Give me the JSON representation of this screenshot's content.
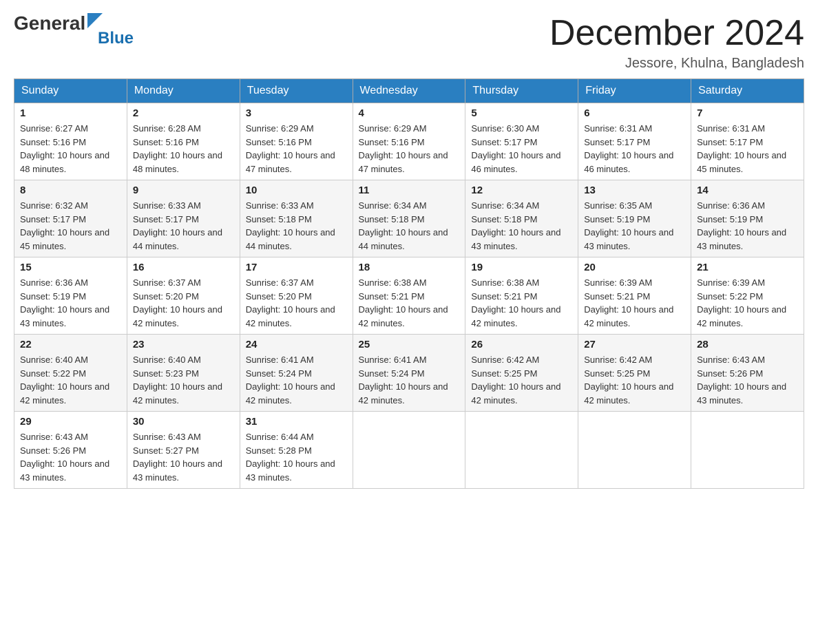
{
  "logo": {
    "general": "General",
    "blue": "Blue"
  },
  "header": {
    "month_year": "December 2024",
    "location": "Jessore, Khulna, Bangladesh"
  },
  "weekdays": [
    "Sunday",
    "Monday",
    "Tuesday",
    "Wednesday",
    "Thursday",
    "Friday",
    "Saturday"
  ],
  "weeks": [
    [
      {
        "day": "1",
        "sunrise": "6:27 AM",
        "sunset": "5:16 PM",
        "daylight": "10 hours and 48 minutes."
      },
      {
        "day": "2",
        "sunrise": "6:28 AM",
        "sunset": "5:16 PM",
        "daylight": "10 hours and 48 minutes."
      },
      {
        "day": "3",
        "sunrise": "6:29 AM",
        "sunset": "5:16 PM",
        "daylight": "10 hours and 47 minutes."
      },
      {
        "day": "4",
        "sunrise": "6:29 AM",
        "sunset": "5:16 PM",
        "daylight": "10 hours and 47 minutes."
      },
      {
        "day": "5",
        "sunrise": "6:30 AM",
        "sunset": "5:17 PM",
        "daylight": "10 hours and 46 minutes."
      },
      {
        "day": "6",
        "sunrise": "6:31 AM",
        "sunset": "5:17 PM",
        "daylight": "10 hours and 46 minutes."
      },
      {
        "day": "7",
        "sunrise": "6:31 AM",
        "sunset": "5:17 PM",
        "daylight": "10 hours and 45 minutes."
      }
    ],
    [
      {
        "day": "8",
        "sunrise": "6:32 AM",
        "sunset": "5:17 PM",
        "daylight": "10 hours and 45 minutes."
      },
      {
        "day": "9",
        "sunrise": "6:33 AM",
        "sunset": "5:17 PM",
        "daylight": "10 hours and 44 minutes."
      },
      {
        "day": "10",
        "sunrise": "6:33 AM",
        "sunset": "5:18 PM",
        "daylight": "10 hours and 44 minutes."
      },
      {
        "day": "11",
        "sunrise": "6:34 AM",
        "sunset": "5:18 PM",
        "daylight": "10 hours and 44 minutes."
      },
      {
        "day": "12",
        "sunrise": "6:34 AM",
        "sunset": "5:18 PM",
        "daylight": "10 hours and 43 minutes."
      },
      {
        "day": "13",
        "sunrise": "6:35 AM",
        "sunset": "5:19 PM",
        "daylight": "10 hours and 43 minutes."
      },
      {
        "day": "14",
        "sunrise": "6:36 AM",
        "sunset": "5:19 PM",
        "daylight": "10 hours and 43 minutes."
      }
    ],
    [
      {
        "day": "15",
        "sunrise": "6:36 AM",
        "sunset": "5:19 PM",
        "daylight": "10 hours and 43 minutes."
      },
      {
        "day": "16",
        "sunrise": "6:37 AM",
        "sunset": "5:20 PM",
        "daylight": "10 hours and 42 minutes."
      },
      {
        "day": "17",
        "sunrise": "6:37 AM",
        "sunset": "5:20 PM",
        "daylight": "10 hours and 42 minutes."
      },
      {
        "day": "18",
        "sunrise": "6:38 AM",
        "sunset": "5:21 PM",
        "daylight": "10 hours and 42 minutes."
      },
      {
        "day": "19",
        "sunrise": "6:38 AM",
        "sunset": "5:21 PM",
        "daylight": "10 hours and 42 minutes."
      },
      {
        "day": "20",
        "sunrise": "6:39 AM",
        "sunset": "5:21 PM",
        "daylight": "10 hours and 42 minutes."
      },
      {
        "day": "21",
        "sunrise": "6:39 AM",
        "sunset": "5:22 PM",
        "daylight": "10 hours and 42 minutes."
      }
    ],
    [
      {
        "day": "22",
        "sunrise": "6:40 AM",
        "sunset": "5:22 PM",
        "daylight": "10 hours and 42 minutes."
      },
      {
        "day": "23",
        "sunrise": "6:40 AM",
        "sunset": "5:23 PM",
        "daylight": "10 hours and 42 minutes."
      },
      {
        "day": "24",
        "sunrise": "6:41 AM",
        "sunset": "5:24 PM",
        "daylight": "10 hours and 42 minutes."
      },
      {
        "day": "25",
        "sunrise": "6:41 AM",
        "sunset": "5:24 PM",
        "daylight": "10 hours and 42 minutes."
      },
      {
        "day": "26",
        "sunrise": "6:42 AM",
        "sunset": "5:25 PM",
        "daylight": "10 hours and 42 minutes."
      },
      {
        "day": "27",
        "sunrise": "6:42 AM",
        "sunset": "5:25 PM",
        "daylight": "10 hours and 42 minutes."
      },
      {
        "day": "28",
        "sunrise": "6:43 AM",
        "sunset": "5:26 PM",
        "daylight": "10 hours and 43 minutes."
      }
    ],
    [
      {
        "day": "29",
        "sunrise": "6:43 AM",
        "sunset": "5:26 PM",
        "daylight": "10 hours and 43 minutes."
      },
      {
        "day": "30",
        "sunrise": "6:43 AM",
        "sunset": "5:27 PM",
        "daylight": "10 hours and 43 minutes."
      },
      {
        "day": "31",
        "sunrise": "6:44 AM",
        "sunset": "5:28 PM",
        "daylight": "10 hours and 43 minutes."
      },
      null,
      null,
      null,
      null
    ]
  ]
}
